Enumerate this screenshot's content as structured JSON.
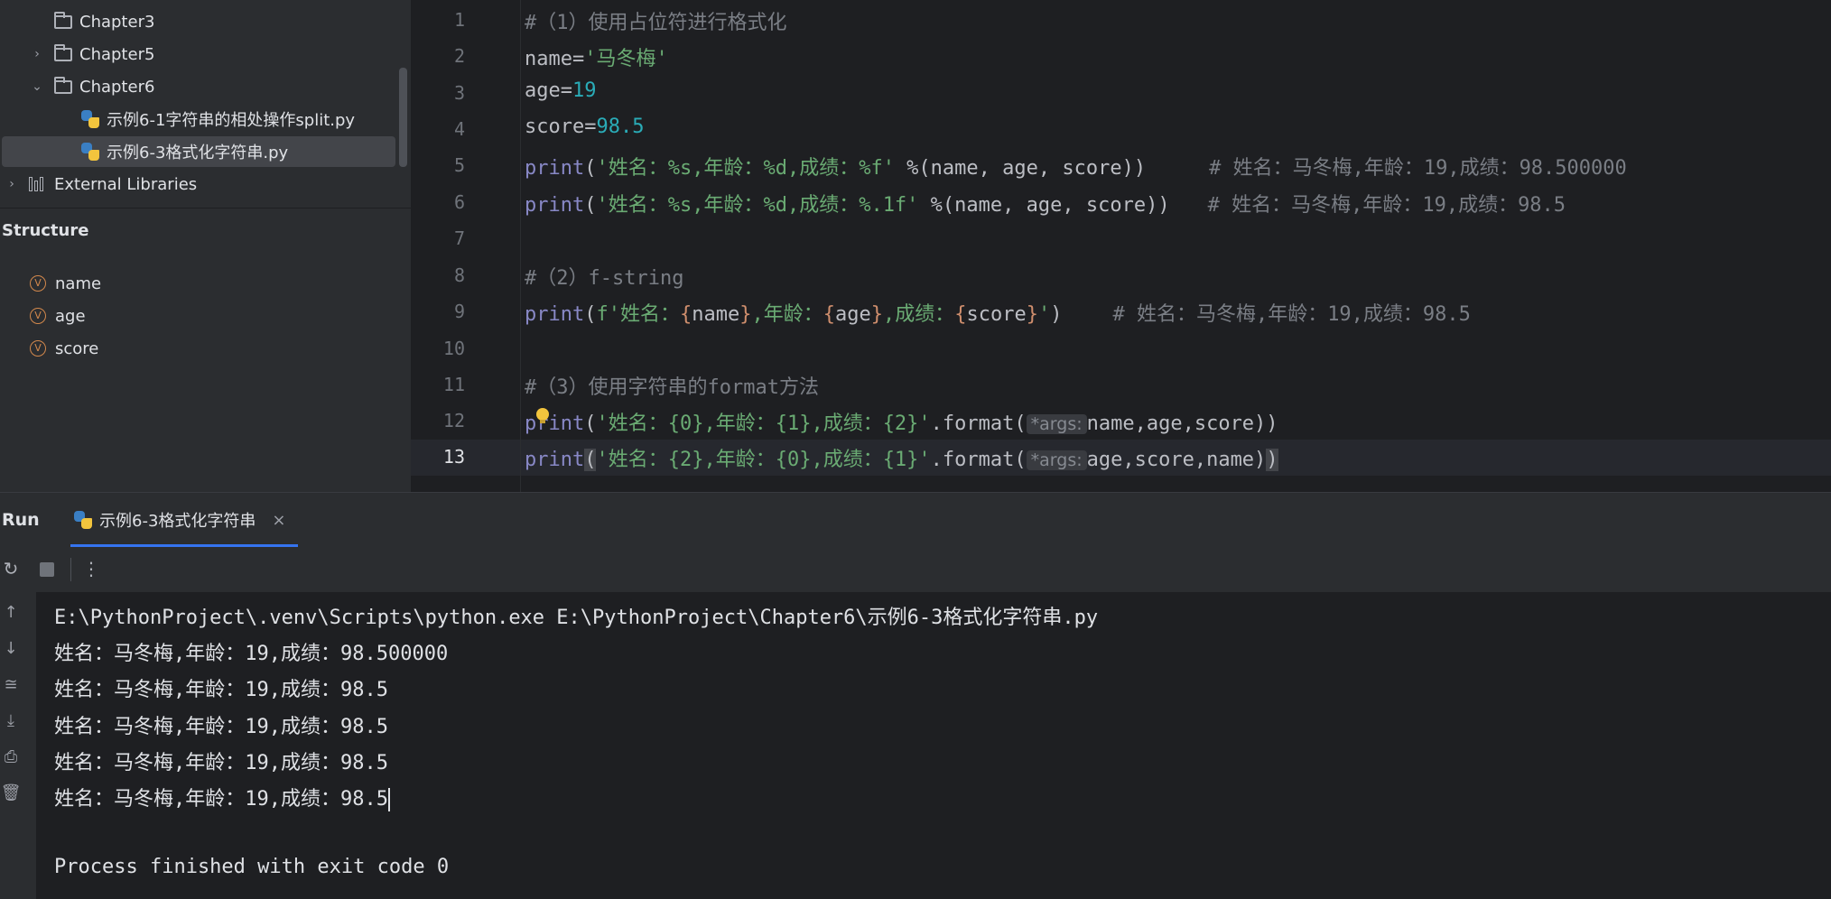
{
  "project_tree": {
    "items": [
      {
        "label": "Chapter3"
      },
      {
        "label": "Chapter5"
      },
      {
        "label": "Chapter6"
      },
      {
        "label": "示例6-1字符串的相处操作split.py"
      },
      {
        "label": "示例6-3格式化字符串.py"
      },
      {
        "label": "External Libraries"
      }
    ]
  },
  "structure": {
    "title": "Structure",
    "items": [
      "name",
      "age",
      "score"
    ],
    "var_badge": "V"
  },
  "editor": {
    "line_numbers": [
      "1",
      "2",
      "3",
      "4",
      "5",
      "6",
      "7",
      "8",
      "9",
      "10",
      "11",
      "12",
      "13"
    ],
    "tokens": {
      "l1": "#（1）使用占位符进行格式化",
      "l2a": "name=",
      "l2b": "'马冬梅'",
      "l3a": "age=",
      "l3b": "19",
      "l4a": "score=",
      "l4b": "98.5",
      "print": "print",
      "lparen": "(",
      "l5str": "'姓名：%s,年龄：%d,成绩：%f'",
      "l5rest": " %(name, age, score))",
      "l5cmt": "# 姓名：马冬梅,年龄：19,成绩：98.500000",
      "l6str": "'姓名：%s,年龄：%d,成绩：%.1f'",
      "l6rest": " %(name, age, score))",
      "l6cmt": "# 姓名：马冬梅,年龄：19,成绩：98.5",
      "l8": "#（2）f-string",
      "l9a": "f'姓名：",
      "l9b": "{",
      "l9c": "name",
      "l9d": "}",
      "l9e": ",年龄：",
      "l9f": "age",
      "l9g": ",成绩：",
      "l9h": "score",
      "l9i": "'",
      "l9j": ")",
      "l9cmt": "# 姓名：马冬梅,年龄：19,成绩：98.5",
      "l11": "#（3）使用字符串的format方法",
      "l12str": "'姓名：{0},年龄：{1},成绩：{2}'",
      "format": ".format(",
      "hint": "*args:",
      "l12args": "name,age,score))",
      "l13str": "'姓名：{2},年龄：{0},成绩：{1}'",
      "l13args": "age,score,name)",
      "rparen": ")"
    }
  },
  "run": {
    "label": "Run",
    "tab_label": "示例6-3格式化字符串",
    "close": "×",
    "more": "⋮",
    "output": [
      "E:\\PythonProject\\.venv\\Scripts\\python.exe E:\\PythonProject\\Chapter6\\示例6-3格式化字符串.py",
      "姓名：马冬梅,年龄：19,成绩：98.500000",
      "姓名：马冬梅,年龄：19,成绩：98.5",
      "姓名：马冬梅,年龄：19,成绩：98.5",
      "姓名：马冬梅,年龄：19,成绩：98.5",
      "姓名：马冬梅,年龄：19,成绩：98.5",
      "",
      "Process finished with exit code 0"
    ]
  },
  "colors": {
    "accent": "#3574f0",
    "string": "#6aab73",
    "number": "#2aacb8",
    "comment": "#7a7e85",
    "builtin": "#8888c6"
  }
}
